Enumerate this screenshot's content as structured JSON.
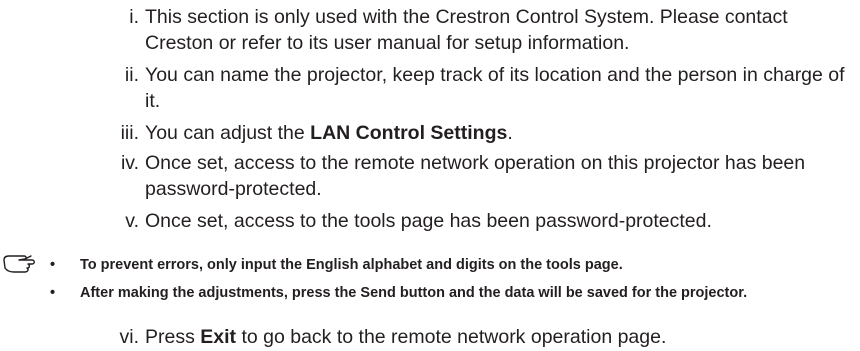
{
  "items": [
    {
      "num": "i.",
      "text": "This section is only used with the Crestron Control System. Please contact Creston or refer to its user manual for setup information."
    },
    {
      "num": "ii.",
      "text": "You can name the projector, keep track of its location and the person in charge of it."
    },
    {
      "num": "iii.",
      "text_before": "You can adjust the ",
      "bold": "LAN Control Settings",
      "text_after": "."
    },
    {
      "num": "iv.",
      "text": "Once set, access to the remote network operation on this projector has been password-protected."
    },
    {
      "num": "v.",
      "text": "Once set, access to the tools page has been password-protected."
    }
  ],
  "notes": {
    "icon": "note-hand-icon",
    "bullets": [
      {
        "bullet": "•",
        "text": "To prevent errors, only input the English alphabet and digits on the tools page."
      },
      {
        "bullet": "•",
        "text": "After making the adjustments, press the Send button and the data will be saved for the projector."
      }
    ]
  },
  "final_item": {
    "num": "vi.",
    "text_before": "Press ",
    "bold": "Exit",
    "text_after": " to go back to the remote network operation page."
  }
}
